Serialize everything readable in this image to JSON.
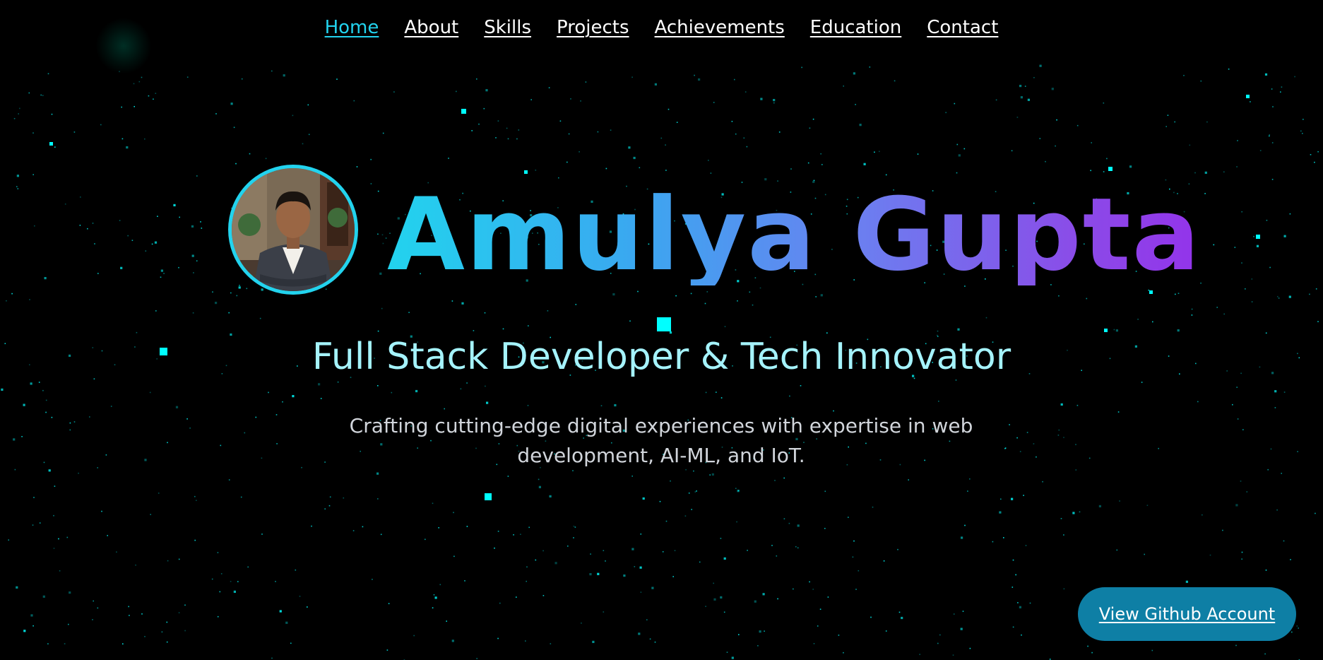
{
  "nav": {
    "items": [
      {
        "label": "Home",
        "active": true
      },
      {
        "label": "About"
      },
      {
        "label": "Skills"
      },
      {
        "label": "Projects"
      },
      {
        "label": "Achievements"
      },
      {
        "label": "Education"
      },
      {
        "label": "Contact"
      }
    ]
  },
  "hero": {
    "name": "Amulya Gupta",
    "subtitle": "Full Stack Developer & Tech Innovator",
    "description": "Crafting cutting-edge digital experiences with expertise in web development, AI-ML, and IoT.",
    "cta_label": "View Github Account"
  },
  "colors": {
    "background": "#000000",
    "accent": "#22d3ee",
    "subtitle": "#a5f3fc",
    "gradient_start": "#22d3ee",
    "gradient_end": "#9333ea",
    "button": "#0e7fa5",
    "particle": "#00ffff"
  }
}
